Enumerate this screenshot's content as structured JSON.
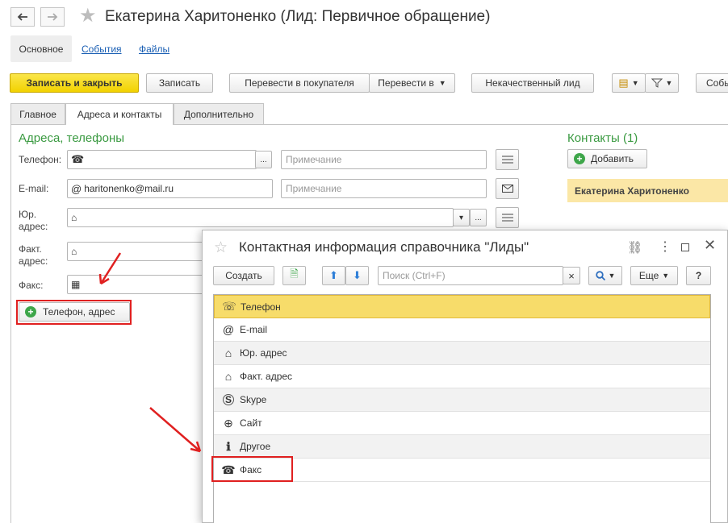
{
  "window": {
    "title": "Екатерина Харитоненко (Лид: Первичное обращение)"
  },
  "topnav": {
    "main": "Основное",
    "events": "События",
    "files": "Файлы"
  },
  "toolbar": {
    "save_close": "Записать и закрыть",
    "save": "Записать",
    "to_buyer": "Перевести в покупателя",
    "to_menu": "Перевести в",
    "bad_lead": "Некачественный лид",
    "more_cut": "Собы"
  },
  "tabs": [
    "Главное",
    "Адреса и контакты",
    "Дополнительно"
  ],
  "addresses": {
    "title": "Адреса, телефоны",
    "phone_label": "Телефон:",
    "email_label": "E-mail:",
    "email_value": "haritonenko@mail.ru",
    "legal_label": "Юр.\nадрес:",
    "legal_label_1": "Юр.",
    "legal_label_2": "адрес:",
    "actual_label_1": "Факт.",
    "actual_label_2": "адрес:",
    "fax_label": "Факс:",
    "note_placeholder": "Примечание",
    "add_button": "Телефон, адрес",
    "dots": "...",
    "dropdown": "▾"
  },
  "contacts": {
    "title": "Контакты (1)",
    "add_button": "Добавить",
    "person": "Екатерина Харитоненко"
  },
  "dialog": {
    "title": "Контактная информация справочника \"Лиды\"",
    "create_button": "Создать",
    "search_placeholder": "Поиск (Ctrl+F)",
    "more_button": "Еще",
    "help_button": "?",
    "clear": "×",
    "items": [
      {
        "label": "Телефон",
        "icon": "phone-icon"
      },
      {
        "label": "E-mail",
        "icon": "at-icon"
      },
      {
        "label": "Юр. адрес",
        "icon": "house-icon"
      },
      {
        "label": "Факт. адрес",
        "icon": "house-icon"
      },
      {
        "label": "Skype",
        "icon": "skype-icon"
      },
      {
        "label": "Сайт",
        "icon": "globe-icon"
      },
      {
        "label": "Другое",
        "icon": "info-icon"
      },
      {
        "label": "Факс",
        "icon": "fax-icon"
      }
    ]
  },
  "colors": {
    "accent_green": "#3ea64a",
    "selection": "#f7dc6a",
    "highlight_red": "#e02020",
    "primary_yellow": "#f2d200"
  }
}
